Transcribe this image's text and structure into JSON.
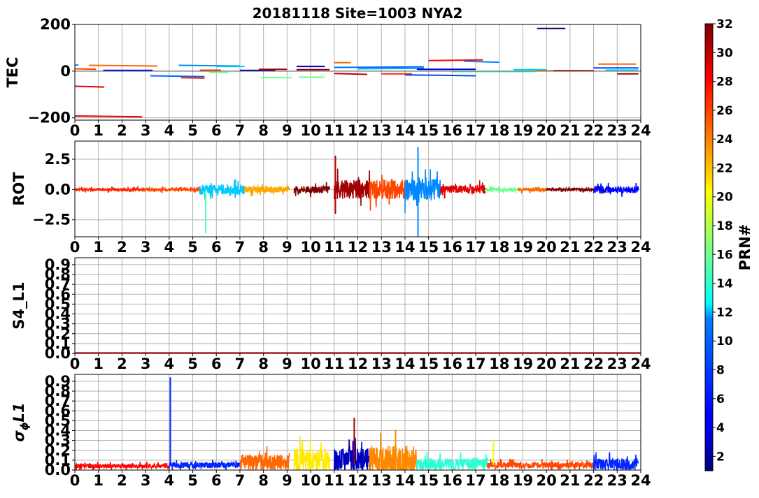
{
  "chart_data": {
    "type": "line",
    "title": "20181118 Site=1003 NYA2",
    "colorbar": {
      "label": "PRN#",
      "colormap": "jet",
      "range": [
        1,
        32
      ],
      "ticks": [
        2,
        4,
        6,
        8,
        10,
        12,
        14,
        16,
        18,
        20,
        22,
        24,
        26,
        28,
        30,
        32
      ]
    },
    "x_ticks": [
      0,
      1,
      2,
      3,
      4,
      5,
      6,
      7,
      8,
      9,
      10,
      11,
      12,
      13,
      14,
      15,
      16,
      17,
      18,
      19,
      20,
      21,
      22,
      23,
      24
    ],
    "panels": [
      {
        "ylabel": "TEC",
        "ylim": [
          -210,
          200
        ],
        "yticks": [
          -200,
          0,
          200
        ],
        "ytick_labels": [
          "−200",
          "0",
          "200"
        ],
        "zero_line": true,
        "series": [
          {
            "prn": 29,
            "x": [
              0,
              1.25
            ],
            "y": [
              -65,
              -68
            ]
          },
          {
            "prn": 29,
            "x": [
              0,
              2.85
            ],
            "y": [
              -192,
              -196
            ]
          },
          {
            "prn": 26,
            "x": [
              0,
              0.9
            ],
            "y": [
              10,
              8
            ]
          },
          {
            "prn": 9,
            "x": [
              0,
              0.15
            ],
            "y": [
              26,
              26
            ]
          },
          {
            "prn": 25,
            "x": [
              0.6,
              3.5
            ],
            "y": [
              25,
              22
            ]
          },
          {
            "prn": 5,
            "x": [
              1.2,
              3.3
            ],
            "y": [
              3,
              3
            ]
          },
          {
            "prn": 8,
            "x": [
              3.2,
              5.5
            ],
            "y": [
              -20,
              -24
            ]
          },
          {
            "prn": 27,
            "x": [
              4.5,
              5.5
            ],
            "y": [
              -28,
              -30
            ]
          },
          {
            "prn": 9,
            "x": [
              4.4,
              7.0
            ],
            "y": [
              25,
              22
            ]
          },
          {
            "prn": 26,
            "x": [
              5.3,
              6.2
            ],
            "y": [
              4,
              4
            ]
          },
          {
            "prn": 16,
            "x": [
              5.7,
              6.5
            ],
            "y": [
              -6,
              -6
            ]
          },
          {
            "prn": 11,
            "x": [
              6.0,
              7.2
            ],
            "y": [
              20,
              20
            ]
          },
          {
            "prn": 3,
            "x": [
              7.0,
              8.5
            ],
            "y": [
              3,
              3
            ]
          },
          {
            "prn": 31,
            "x": [
              7.8,
              9.0
            ],
            "y": [
              8,
              8
            ]
          },
          {
            "prn": 16,
            "x": [
              7.9,
              9.2
            ],
            "y": [
              -28,
              -28
            ]
          },
          {
            "prn": 16,
            "x": [
              9.5,
              10.6
            ],
            "y": [
              -26,
              -26
            ]
          },
          {
            "prn": 3,
            "x": [
              9.4,
              10.6
            ],
            "y": [
              20,
              20
            ]
          },
          {
            "prn": 32,
            "x": [
              9.4,
              10.8
            ],
            "y": [
              6,
              6
            ]
          },
          {
            "prn": 25,
            "x": [
              11.0,
              11.7
            ],
            "y": [
              36,
              36
            ]
          },
          {
            "prn": 30,
            "x": [
              11.0,
              12.4
            ],
            "y": [
              -10,
              -14
            ]
          },
          {
            "prn": 8,
            "x": [
              11.0,
              14.8
            ],
            "y": [
              16,
              18
            ]
          },
          {
            "prn": 10,
            "x": [
              12.0,
              14.8
            ],
            "y": [
              10,
              12
            ]
          },
          {
            "prn": 27,
            "x": [
              13.0,
              14.3
            ],
            "y": [
              -12,
              -12
            ]
          },
          {
            "prn": 7,
            "x": [
              14.0,
              17.0
            ],
            "y": [
              -16,
              -20
            ]
          },
          {
            "prn": 28,
            "x": [
              15.0,
              17.3
            ],
            "y": [
              45,
              48
            ]
          },
          {
            "prn": 9,
            "x": [
              16.5,
              18.0
            ],
            "y": [
              42,
              38
            ]
          },
          {
            "prn": 4,
            "x": [
              14.5,
              17.0
            ],
            "y": [
              8,
              8
            ]
          },
          {
            "prn": 15,
            "x": [
              16.0,
              19.5
            ],
            "y": [
              -2,
              -2
            ]
          },
          {
            "prn": 11,
            "x": [
              18.6,
              20.0
            ],
            "y": [
              6,
              6
            ]
          },
          {
            "prn": 1,
            "x": [
              19.6,
              20.8
            ],
            "y": [
              183,
              183
            ]
          },
          {
            "prn": 24,
            "x": [
              19.5,
              21.5
            ],
            "y": [
              2,
              2
            ]
          },
          {
            "prn": 31,
            "x": [
              20.3,
              22.0
            ],
            "y": [
              2,
              2
            ]
          },
          {
            "prn": 25,
            "x": [
              22.2,
              23.8
            ],
            "y": [
              30,
              30
            ]
          },
          {
            "prn": 7,
            "x": [
              22.0,
              23.9
            ],
            "y": [
              14,
              14
            ]
          },
          {
            "prn": 12,
            "x": [
              22.5,
              23.9
            ],
            "y": [
              5,
              5
            ]
          },
          {
            "prn": 31,
            "x": [
              23.0,
              23.9
            ],
            "y": [
              -12,
              -12
            ]
          }
        ]
      },
      {
        "ylabel": "ROT",
        "ylim": [
          -3.9,
          4.0
        ],
        "yticks": [
          -2.5,
          0.0,
          2.5
        ],
        "ytick_labels": [
          "−2.5",
          "0.0",
          "2.5"
        ],
        "zero_line": false,
        "series": [
          {
            "prn": 27,
            "x": [
              0,
              2.8
            ],
            "y": [
              0,
              0
            ],
            "noise": 0.12
          },
          {
            "prn": 26,
            "x": [
              2.8,
              5.3
            ],
            "y": [
              0,
              0
            ],
            "noise": 0.12
          },
          {
            "prn": 11,
            "x": [
              5.3,
              7.2
            ],
            "y": [
              0,
              0
            ],
            "noise": 0.4
          },
          {
            "prn": 23,
            "x": [
              7.2,
              9.1
            ],
            "y": [
              0,
              0
            ],
            "noise": 0.25
          },
          {
            "prn": 32,
            "x": [
              9.3,
              10.8
            ],
            "y": [
              0,
              0
            ],
            "noise": 0.3
          },
          {
            "prn": 31,
            "x": [
              11.0,
              12.5
            ],
            "y": [
              0,
              0
            ],
            "noise": 0.8
          },
          {
            "prn": 26,
            "x": [
              12.5,
              14.0
            ],
            "y": [
              0,
              0
            ],
            "noise": 0.8
          },
          {
            "prn": 9,
            "x": [
              14.0,
              15.5
            ],
            "y": [
              0,
              0
            ],
            "noise": 0.9
          },
          {
            "prn": 29,
            "x": [
              15.5,
              17.4
            ],
            "y": [
              0,
              0
            ],
            "noise": 0.35
          },
          {
            "prn": 16,
            "x": [
              17.4,
              18.8
            ],
            "y": [
              0,
              0
            ],
            "noise": 0.15
          },
          {
            "prn": 25,
            "x": [
              18.8,
              20.0
            ],
            "y": [
              0,
              0
            ],
            "noise": 0.15
          },
          {
            "prn": 32,
            "x": [
              20.0,
              22.0
            ],
            "y": [
              0,
              0
            ],
            "noise": 0.1
          },
          {
            "prn": 5,
            "x": [
              22.0,
              23.9
            ],
            "y": [
              0,
              0
            ],
            "noise": 0.3
          },
          {
            "prn": 15,
            "x": [
              5.55,
              5.55
            ],
            "y": [
              0,
              -3.6
            ]
          },
          {
            "prn": 9,
            "x": [
              14.55,
              14.55
            ],
            "y": [
              3.5,
              -3.9
            ]
          },
          {
            "prn": 30,
            "x": [
              11.05,
              11.05
            ],
            "y": [
              2.8,
              -2.0
            ]
          }
        ]
      },
      {
        "ylabel": "S4_L1",
        "ylim": [
          0.0,
          0.97
        ],
        "yticks": [
          0.0,
          0.1,
          0.2,
          0.3,
          0.4,
          0.5,
          0.6,
          0.7,
          0.8,
          0.9
        ],
        "ytick_labels": [
          "0.0",
          "0.1",
          "0.2",
          "0.3",
          "0.4",
          "0.5",
          "0.6",
          "0.7",
          "0.8",
          "0.9"
        ],
        "zero_line": false,
        "series": [
          {
            "prn": 28,
            "x": [
              0,
              24
            ],
            "y": [
              0.005,
              0.005
            ]
          }
        ]
      },
      {
        "ylabel": "σ",
        "ylabel_sub": "ϕ",
        "ylabel_tail": "L1",
        "ylim": [
          0.0,
          0.97
        ],
        "yticks": [
          0.0,
          0.1,
          0.2,
          0.3,
          0.4,
          0.5,
          0.6,
          0.7,
          0.8,
          0.9
        ],
        "ytick_labels": [
          "0.0",
          "0.1",
          "0.2",
          "0.3",
          "0.4",
          "0.5",
          "0.6",
          "0.7",
          "0.8",
          "0.9"
        ],
        "zero_line": false,
        "series": [
          {
            "prn": 28,
            "x": [
              0,
              4.0
            ],
            "y": [
              0.04,
              0.04
            ],
            "noise": 0.02
          },
          {
            "prn": 6,
            "x": [
              4.0,
              7.0
            ],
            "y": [
              0.05,
              0.05
            ],
            "noise": 0.03
          },
          {
            "prn": 25,
            "x": [
              7.0,
              9.1
            ],
            "y": [
              0.08,
              0.08
            ],
            "noise": 0.08
          },
          {
            "prn": 21,
            "x": [
              9.3,
              10.8
            ],
            "y": [
              0.1,
              0.1
            ],
            "noise": 0.12
          },
          {
            "prn": 3,
            "x": [
              11.0,
              12.5
            ],
            "y": [
              0.1,
              0.1
            ],
            "noise": 0.12
          },
          {
            "prn": 24,
            "x": [
              12.5,
              14.5
            ],
            "y": [
              0.1,
              0.1
            ],
            "noise": 0.15
          },
          {
            "prn": 14,
            "x": [
              14.5,
              17.5
            ],
            "y": [
              0.06,
              0.06
            ],
            "noise": 0.06
          },
          {
            "prn": 26,
            "x": [
              17.5,
              22.0
            ],
            "y": [
              0.05,
              0.05
            ],
            "noise": 0.03
          },
          {
            "prn": 6,
            "x": [
              22.0,
              23.9
            ],
            "y": [
              0.06,
              0.06
            ],
            "noise": 0.06
          },
          {
            "prn": 6,
            "x": [
              4.05,
              4.05
            ],
            "y": [
              0.04,
              0.94
            ]
          },
          {
            "prn": 31,
            "x": [
              11.85,
              11.85
            ],
            "y": [
              0.05,
              0.53
            ]
          },
          {
            "prn": 24,
            "x": [
              13.6,
              13.6
            ],
            "y": [
              0.05,
              0.41
            ]
          },
          {
            "prn": 20,
            "x": [
              17.75,
              17.75
            ],
            "y": [
              0.05,
              0.3
            ]
          }
        ]
      }
    ]
  }
}
